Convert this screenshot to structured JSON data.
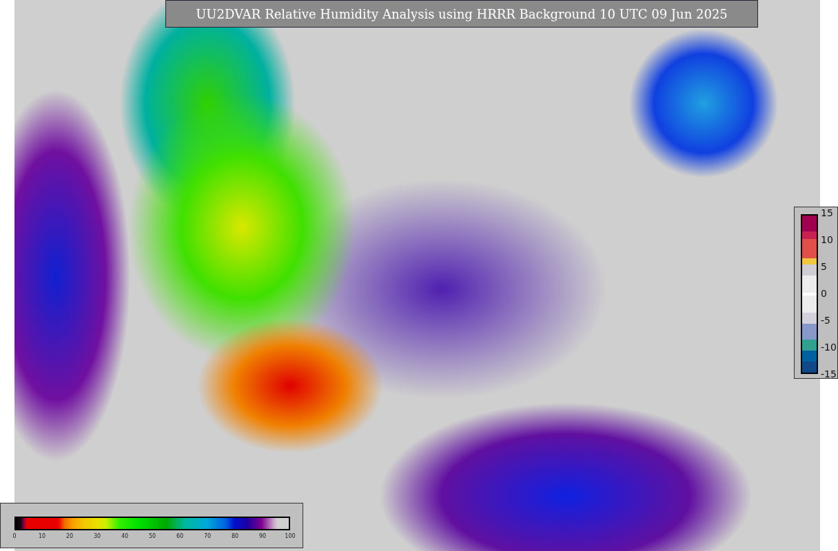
{
  "title": "UU2DVAR Relative Humidity Analysis using HRRR Background 10 UTC 09 Jun 2025",
  "right_colorbar": {
    "ticks": [
      "15",
      "10",
      "5",
      "0",
      "-5",
      "-10",
      "-15"
    ]
  },
  "bottom_colorbar": {
    "ticks": [
      "0",
      "10",
      "20",
      "30",
      "40",
      "50",
      "60",
      "70",
      "80",
      "90",
      "100"
    ]
  }
}
